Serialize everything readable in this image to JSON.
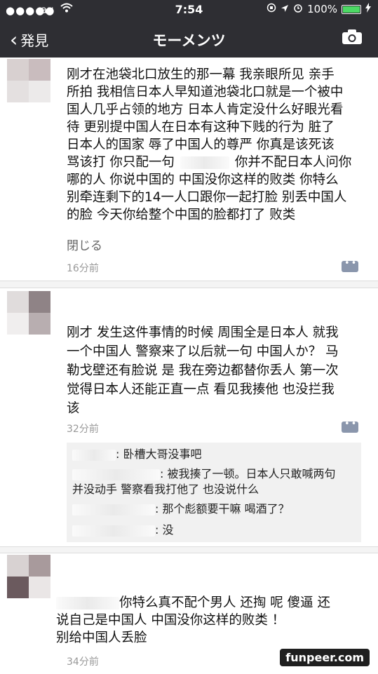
{
  "status": {
    "signal": "●●●●●",
    "carrier": "au",
    "time": "7:54",
    "battery": "100%"
  },
  "nav": {
    "back_label": "発見",
    "title": "モーメンツ"
  },
  "posts": [
    {
      "lines": [
        "刚才在池袋北口放生的那一幕 我亲眼所见 亲手",
        "所拍 我相信日本人早知道池袋北口就是一个被中",
        "国人几乎占领的地方 日本人肯定没什么好眼光看",
        "待 更别提中国人在日本有这种下贱的行为 脏了",
        "日本人的国家 辱了中国人的尊严 你真是该死该",
        "骂该打  你只配一句",
        "你并不配日本人问你",
        "哪的人 你说中国的 中国没你这样的败类 你特么",
        "别牵连剩下的14一人口跟你一起打脸 别丢中国人",
        "的脸 今天你给整个中国的脸都打了 败类"
      ],
      "collapse_label": "閉じる",
      "time": "16分前"
    },
    {
      "lines": [
        "刚才 发生这件事情的时候 周围全是日本人 就我",
        "一个中国人 警察来了以后就一句 中国人か？ 马",
        "勒戈壁还有脸说 是 我在旁边都替你丢人 第一次",
        "觉得日本人还能正直一点 看见我揍他 也没拦我",
        "该"
      ],
      "time": "32分前",
      "comments": [
        ": 卧槽大哥没事吧",
        ": 被我揍了一顿。日本人只敢喊两句",
        "并没动手 警察看我打他了 也没说什么",
        ": 那个彪额要干嘛 喝酒了？",
        ": 没"
      ]
    },
    {
      "lines": [
        "你特么真不配个男人 还掏   呢 傻逼 还",
        "说自己是中国人 中国没你这样的败类 ！",
        "别给中国人丢脸"
      ],
      "time": "34分前"
    }
  ],
  "watermark": "funpeer.com"
}
